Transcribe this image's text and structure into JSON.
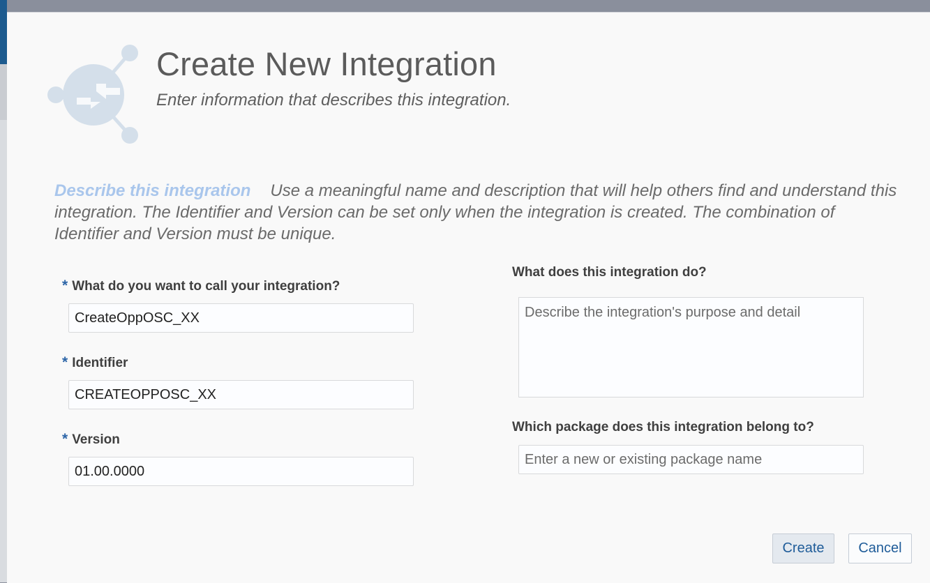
{
  "dialog": {
    "title": "Create New Integration",
    "subtitle": "Enter information that describes this integration.",
    "icon": "integration-arrows-icon"
  },
  "intro": {
    "lead": "Describe this integration",
    "text": "Use a meaningful name and description that will help others find and understand this integration. The Identifier and Version can be set only when the integration is created. The combination of Identifier and Version must be unique."
  },
  "form": {
    "required_marker": "*",
    "name": {
      "label": "What do you want to call your integration?",
      "value": "CreateOppOSC_XX"
    },
    "identifier": {
      "label": "Identifier",
      "value": "CREATEOPPOSC_XX"
    },
    "version": {
      "label": "Version",
      "value": "01.00.0000"
    },
    "description": {
      "label": "What does this integration do?",
      "placeholder": "Describe the integration's purpose and detail"
    },
    "package": {
      "label": "Which package does this integration belong to?",
      "placeholder": "Enter a new or existing package name"
    }
  },
  "buttons": {
    "create": "Create",
    "cancel": "Cancel"
  },
  "colors": {
    "accent": "#2e66a8",
    "lead_text": "#a9c6ec",
    "logo": "#d4dfea",
    "button_text": "#1f5c99"
  }
}
